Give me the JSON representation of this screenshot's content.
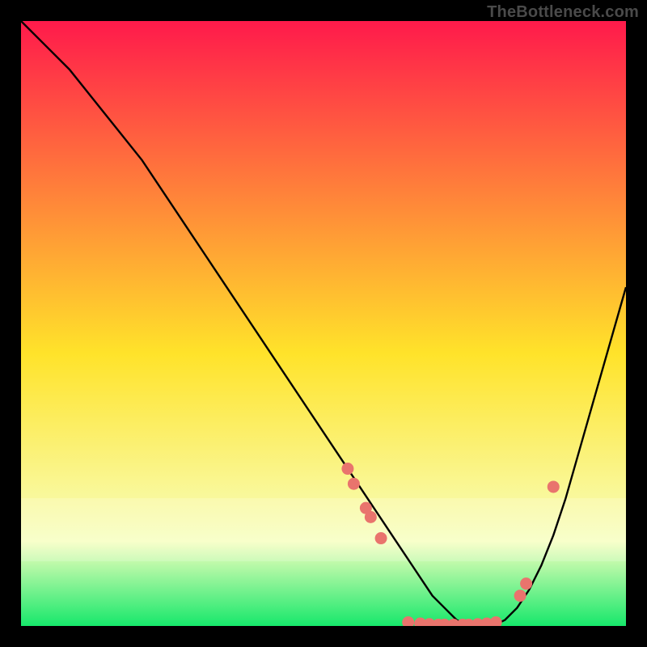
{
  "watermark": "TheBottleneck.com",
  "colors": {
    "background": "#000000",
    "gradient_top": "#ff1a4b",
    "gradient_mid": "#ffe32a",
    "gradient_haze": "#f7ffbf",
    "gradient_bottom": "#17e86b",
    "curve": "#000000",
    "marker": "#e9746d"
  },
  "chart_data": {
    "type": "line",
    "title": "",
    "xlabel": "",
    "ylabel": "",
    "xlim": [
      0,
      100
    ],
    "ylim": [
      0,
      100
    ],
    "series": [
      {
        "name": "bottleneck-curve",
        "x": [
          0,
          4,
          8,
          12,
          16,
          20,
          24,
          28,
          32,
          36,
          40,
          44,
          48,
          52,
          56,
          60,
          62,
          64,
          66,
          68,
          70,
          72,
          74,
          76,
          78,
          80,
          82,
          84,
          86,
          88,
          90,
          92,
          94,
          96,
          98,
          100
        ],
        "y": [
          100,
          96,
          92,
          87,
          82,
          77,
          71,
          65,
          59,
          53,
          47,
          41,
          35,
          29,
          23,
          17,
          14,
          11,
          8,
          5,
          3,
          1,
          0,
          0,
          0,
          1,
          3,
          6,
          10,
          15,
          21,
          28,
          35,
          42,
          49,
          56
        ]
      }
    ],
    "markers": [
      {
        "x": 54,
        "y": 26
      },
      {
        "x": 55,
        "y": 23.5
      },
      {
        "x": 57,
        "y": 19.5
      },
      {
        "x": 57.8,
        "y": 18
      },
      {
        "x": 59.5,
        "y": 14.5
      },
      {
        "x": 64,
        "y": 0.6
      },
      {
        "x": 66,
        "y": 0.4
      },
      {
        "x": 67.5,
        "y": 0.3
      },
      {
        "x": 69,
        "y": 0.2
      },
      {
        "x": 70,
        "y": 0.2
      },
      {
        "x": 71.5,
        "y": 0.2
      },
      {
        "x": 73,
        "y": 0.2
      },
      {
        "x": 74,
        "y": 0.2
      },
      {
        "x": 75.5,
        "y": 0.3
      },
      {
        "x": 77,
        "y": 0.4
      },
      {
        "x": 78.5,
        "y": 0.6
      },
      {
        "x": 82.5,
        "y": 5
      },
      {
        "x": 83.5,
        "y": 7
      },
      {
        "x": 88,
        "y": 23
      }
    ]
  }
}
